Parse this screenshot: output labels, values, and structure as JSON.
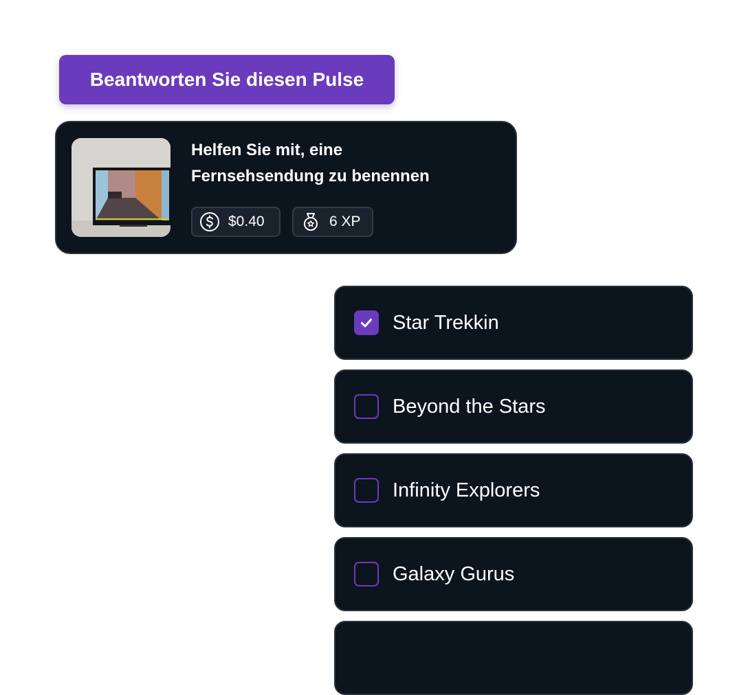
{
  "cta": {
    "label": "Beantworten Sie diesen Pulse"
  },
  "task": {
    "title_line1": "Helfen Sie mit, eine",
    "title_line2": "Fernsehsendung zu benennen",
    "reward": "$0.40",
    "xp": "6 XP",
    "thumbnail_icon": "tv-on-wall-photo"
  },
  "options": [
    {
      "label": "Star Trekkin",
      "checked": true
    },
    {
      "label": "Beyond the Stars",
      "checked": false
    },
    {
      "label": "Infinity Explorers",
      "checked": false
    },
    {
      "label": "Galaxy Gurus",
      "checked": false
    },
    {
      "label": "",
      "checked": false
    }
  ],
  "colors": {
    "accent": "#6a3bbd",
    "card_bg": "#0c141e",
    "card_border": "#2a323d",
    "text": "#ffffff"
  },
  "icons": {
    "reward": "dollar-coin-icon",
    "xp": "medal-icon",
    "checked": "check-icon"
  }
}
